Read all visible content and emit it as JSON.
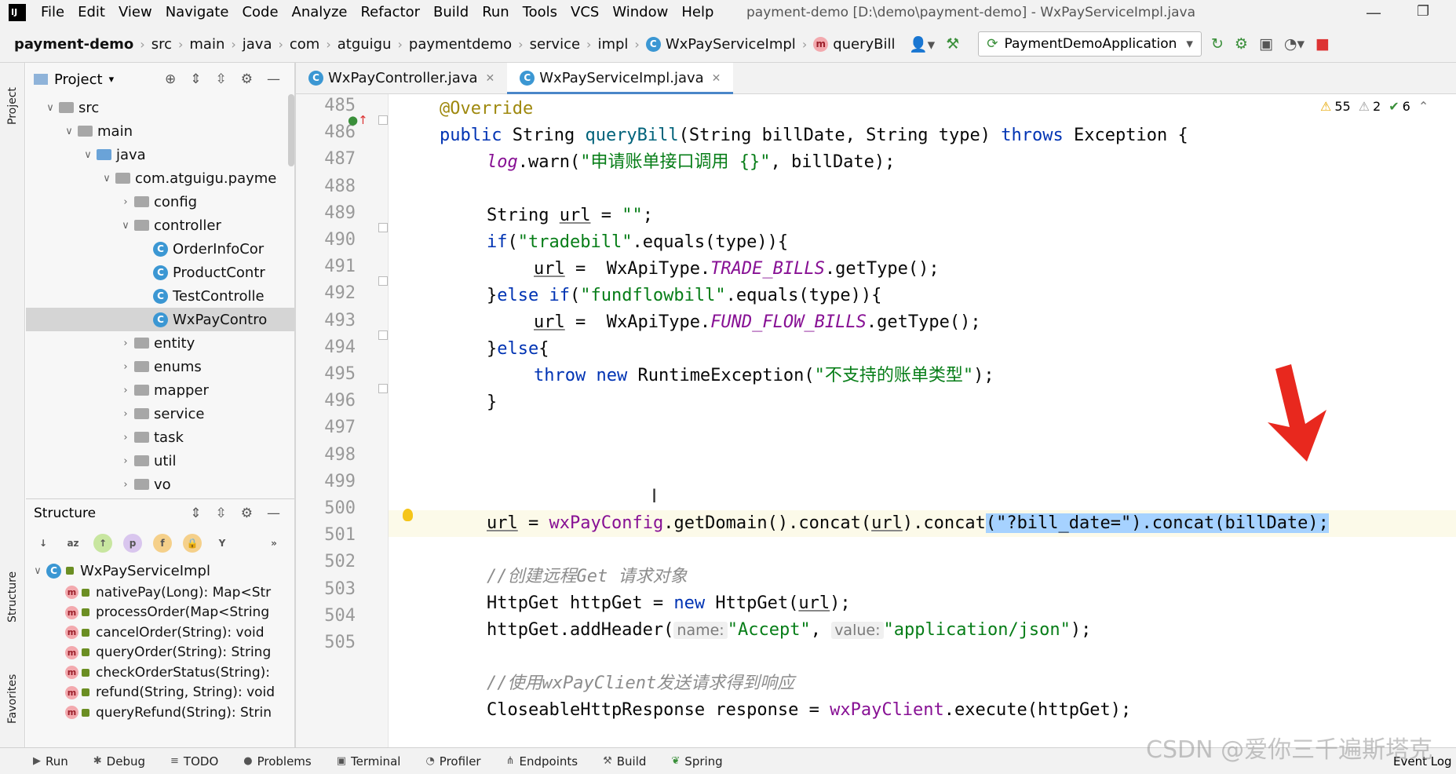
{
  "menubar": {
    "items": [
      "File",
      "Edit",
      "View",
      "Navigate",
      "Code",
      "Analyze",
      "Refactor",
      "Build",
      "Run",
      "Tools",
      "VCS",
      "Window",
      "Help"
    ],
    "window_title": "payment-demo [D:\\demo\\payment-demo] - WxPayServiceImpl.java"
  },
  "breadcrumbs": [
    "payment-demo",
    "src",
    "main",
    "java",
    "com",
    "atguigu",
    "paymentdemo",
    "service",
    "impl",
    "WxPayServiceImpl",
    "queryBill"
  ],
  "toolbar": {
    "run_config": "PaymentDemoApplication"
  },
  "side_tabs": {
    "project": "Project",
    "structure": "Structure",
    "favorites": "Favorites"
  },
  "project_panel": {
    "title": "Project",
    "tree": [
      {
        "label": "src",
        "level": 1,
        "arrow": "v",
        "type": "folder"
      },
      {
        "label": "main",
        "level": 2,
        "arrow": "v",
        "type": "folder"
      },
      {
        "label": "java",
        "level": 3,
        "arrow": "v",
        "type": "folder-blue"
      },
      {
        "label": "com.atguigu.payme",
        "level": 4,
        "arrow": "v",
        "type": "folder"
      },
      {
        "label": "config",
        "level": 5,
        "arrow": ">",
        "type": "folder"
      },
      {
        "label": "controller",
        "level": 5,
        "arrow": "v",
        "type": "folder"
      },
      {
        "label": "OrderInfoCor",
        "level": 6,
        "arrow": "",
        "type": "class"
      },
      {
        "label": "ProductContr",
        "level": 6,
        "arrow": "",
        "type": "class"
      },
      {
        "label": "TestControlle",
        "level": 6,
        "arrow": "",
        "type": "class"
      },
      {
        "label": "WxPayContro",
        "level": 6,
        "arrow": "",
        "type": "class",
        "selected": true
      },
      {
        "label": "entity",
        "level": 5,
        "arrow": ">",
        "type": "folder"
      },
      {
        "label": "enums",
        "level": 5,
        "arrow": ">",
        "type": "folder"
      },
      {
        "label": "mapper",
        "level": 5,
        "arrow": ">",
        "type": "folder"
      },
      {
        "label": "service",
        "level": 5,
        "arrow": ">",
        "type": "folder"
      },
      {
        "label": "task",
        "level": 5,
        "arrow": ">",
        "type": "folder"
      },
      {
        "label": "util",
        "level": 5,
        "arrow": ">",
        "type": "folder"
      },
      {
        "label": "vo",
        "level": 5,
        "arrow": ">",
        "type": "folder"
      }
    ]
  },
  "structure_panel": {
    "title": "Structure",
    "root": "WxPayServiceImpl",
    "methods": [
      "nativePay(Long): Map<Str",
      "processOrder(Map<String",
      "cancelOrder(String): void",
      "queryOrder(String): String",
      "checkOrderStatus(String):",
      "refund(String, String): void",
      "queryRefund(String): Strin"
    ]
  },
  "editor_tabs": [
    {
      "label": "WxPayController.java",
      "active": false
    },
    {
      "label": "WxPayServiceImpl.java",
      "active": true
    }
  ],
  "inspections": {
    "warnings": "55",
    "weak_warnings": "2",
    "typos": "6"
  },
  "code": {
    "line_numbers": [
      "485",
      "486",
      "487",
      "488",
      "489",
      "490",
      "491",
      "492",
      "493",
      "494",
      "495",
      "496",
      "497",
      "498",
      "499",
      "500",
      "501",
      "502",
      "503",
      "504",
      "505"
    ],
    "l485": "@Override",
    "l486_a": "public",
    "l486_b": " String ",
    "l486_c": "queryBill",
    "l486_d": "(String billDate, String type) ",
    "l486_e": "throws",
    "l486_f": " Exception {",
    "l487_a": "log",
    "l487_b": ".warn(",
    "l487_c": "\"申请账单接口调用 {}\"",
    "l487_d": ", billDate);",
    "l489_a": "String ",
    "l489_b": "url",
    "l489_c": " = ",
    "l489_d": "\"\"",
    "l489_e": ";",
    "l490_a": "if",
    "l490_b": "(",
    "l490_c": "\"tradebill\"",
    "l490_d": ".equals(type)){",
    "l491_a": "url",
    "l491_b": " =  WxApiType.",
    "l491_c": "TRADE_BILLS",
    "l491_d": ".getType();",
    "l492_a": "}",
    "l492_b": "else if",
    "l492_c": "(",
    "l492_d": "\"fundflowbill\"",
    "l492_e": ".equals(type)){",
    "l493_a": "url",
    "l493_b": " =  WxApiType.",
    "l493_c": "FUND_FLOW_BILLS",
    "l493_d": ".getType();",
    "l494_a": "}",
    "l494_b": "else",
    "l494_c": "{",
    "l495_a": "throw new",
    "l495_b": " RuntimeException(",
    "l495_c": "\"不支持的账单类型\"",
    "l495_d": ");",
    "l496": "}",
    "l498_a": "url",
    "l498_b": " = ",
    "l498_c": "wxPayConfig",
    "l498_d": ".getDomain().concat(",
    "l498_e": "url",
    "l498_f": ").concat",
    "l498_g": "(\"?bill_date=\").concat(billDate);",
    "l500": "//创建远程Get 请求对象",
    "l501_a": "HttpGet httpGet = ",
    "l501_b": "new",
    "l501_c": " HttpGet(",
    "l501_d": "url",
    "l501_e": ");",
    "l502_a": "httpGet.addHeader(",
    "l502_b": "name:",
    "l502_c": "\"Accept\"",
    "l502_d": ", ",
    "l502_e": "value:",
    "l502_f": "\"application/json\"",
    "l502_g": ");",
    "l504": "//使用wxPayClient发送请求得到响应",
    "l505_a": "CloseableHttpResponse response = ",
    "l505_b": "wxPayClient",
    "l505_c": ".execute(httpGet);"
  },
  "bottom_tabs": [
    "Run",
    "Debug",
    "TODO",
    "Problems",
    "Terminal",
    "Profiler",
    "Endpoints",
    "Build",
    "Spring"
  ],
  "bottom_right": "Event Log",
  "watermark": "CSDN @爱你三千遍斯塔克"
}
